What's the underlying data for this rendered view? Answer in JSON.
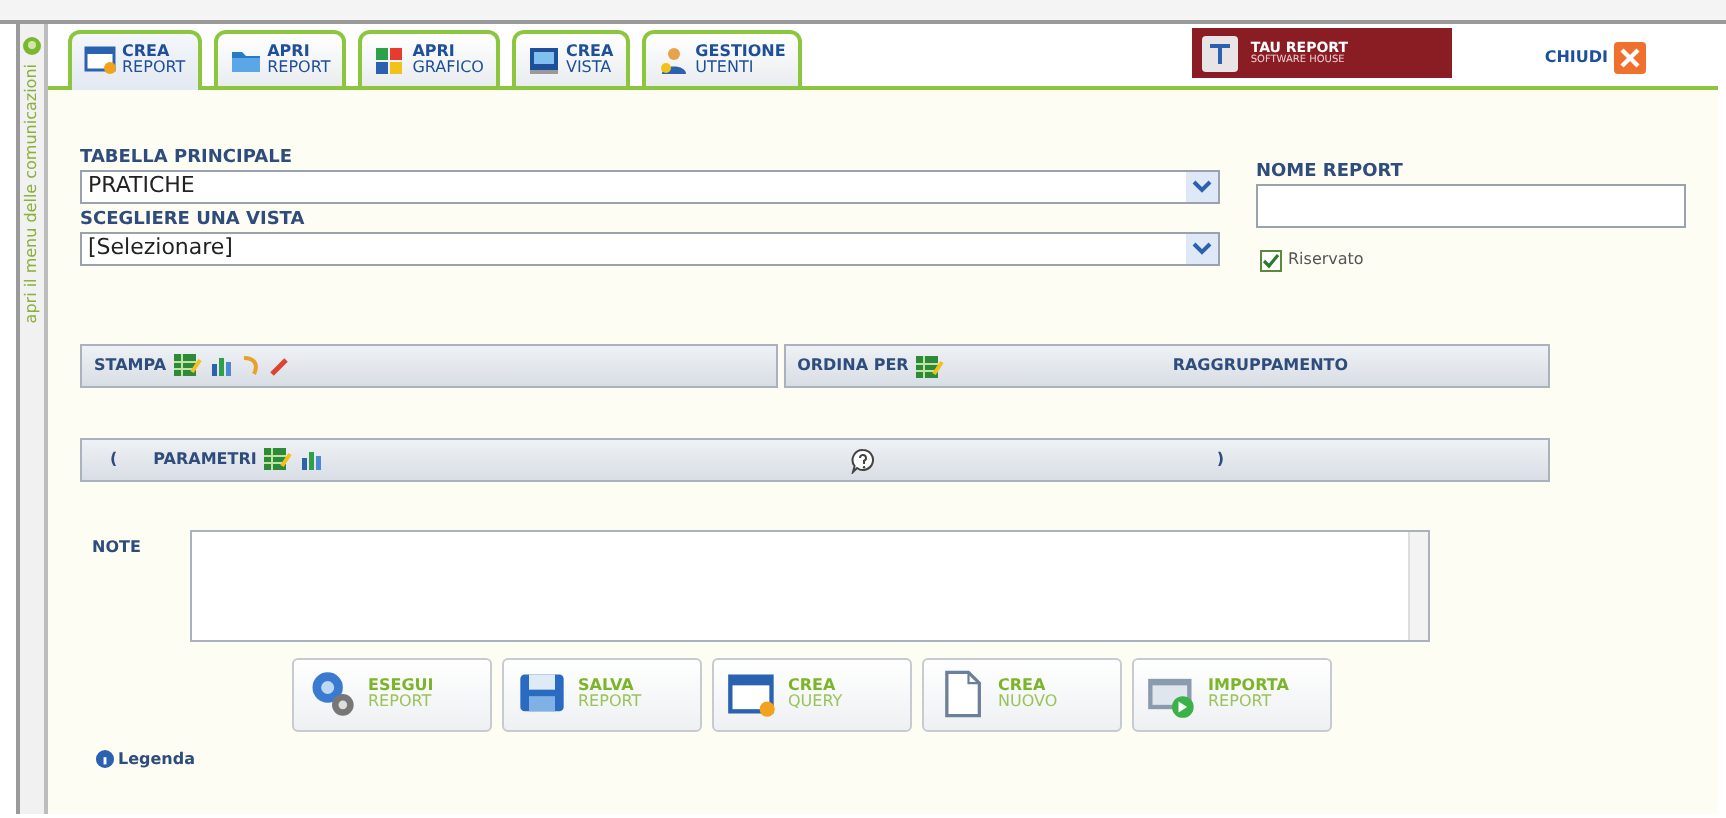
{
  "sidebar": {
    "label": "apri il menu delle comunicazioni"
  },
  "tabs": [
    {
      "line1": "CREA",
      "line2": "REPORT",
      "selected": true
    },
    {
      "line1": "APRI",
      "line2": "REPORT",
      "selected": false
    },
    {
      "line1": "APRI",
      "line2": "GRAFICO",
      "selected": false
    },
    {
      "line1": "CREA",
      "line2": "VISTA",
      "selected": false
    },
    {
      "line1": "GESTIONE",
      "line2": "UTENTI",
      "selected": false
    }
  ],
  "logo": {
    "line1": "TAU REPORT",
    "line2": "SOFTWARE HOUSE"
  },
  "close": {
    "label": "CHIUDI"
  },
  "form": {
    "main_table": {
      "label": "TABELLA PRINCIPALE",
      "value": "PRATICHE"
    },
    "view": {
      "label": "SCEGLIERE UNA VISTA",
      "value": "[Selezionare]"
    },
    "report_name": {
      "label": "NOME REPORT"
    },
    "reserved": {
      "label": "Riservato",
      "checked": true
    }
  },
  "sections": {
    "print": "STAMPA",
    "order": "ORDINA PER",
    "group": "RAGGRUPPAMENTO",
    "open_paren": "(",
    "params": "PARAMETRI",
    "close_paren": ")"
  },
  "note": {
    "label": "NOTE"
  },
  "actions": [
    {
      "line1": "ESEGUI",
      "line2": "REPORT"
    },
    {
      "line1": "SALVA",
      "line2": "REPORT"
    },
    {
      "line1": "CREA",
      "line2": "QUERY"
    },
    {
      "line1": "CREA",
      "line2": "NUOVO"
    },
    {
      "line1": "IMPORTA",
      "line2": "REPORT"
    }
  ],
  "legend": {
    "label": "Legenda"
  }
}
